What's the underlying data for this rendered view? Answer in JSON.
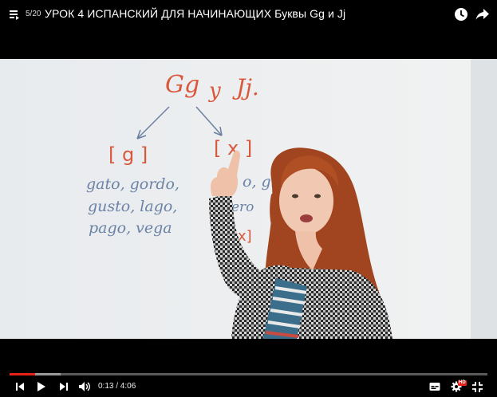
{
  "header": {
    "playlist_position": "5/20",
    "video_title": "УРОК 4 ИСПАНСКИЙ ДЛЯ НАЧИНАЮЩИХ Буквы Gg и Jj"
  },
  "whiteboard": {
    "heading_g": "Gg",
    "heading_y": "y",
    "heading_j": "Jj.",
    "left_symbol": "[ g ]",
    "right_symbol": "[ x ]",
    "left_words": [
      "gato, gordo,",
      "gusto, lago,",
      "pago, vega"
    ],
    "right_words": [
      "o, gito",
      "ero"
    ],
    "right_symbol_2": "[x]"
  },
  "player": {
    "current_time": "0:13",
    "time_separator": " / ",
    "duration": "4:06",
    "time_display": "0:13 / 4:06",
    "played_fraction": 0.053,
    "buffered_fraction": 0.107,
    "hd_label": "HD",
    "accent_color": "#e62117"
  }
}
